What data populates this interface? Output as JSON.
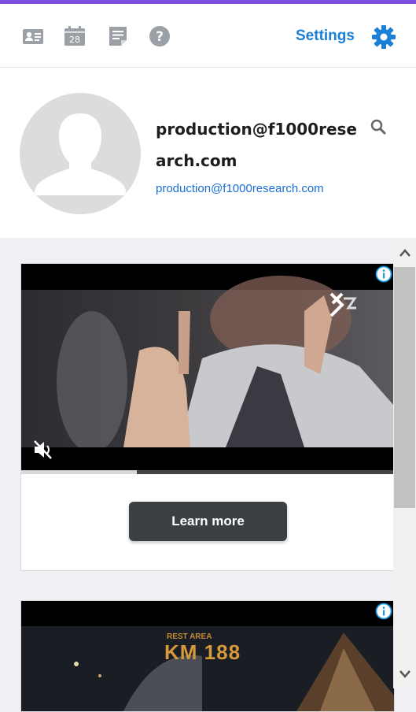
{
  "toolbar": {
    "icons": [
      "contact-card-icon",
      "calendar-icon",
      "notes-icon",
      "help-icon"
    ],
    "calendar_day": "28",
    "settings_label": "Settings",
    "accent_color": "#1a7fd6",
    "top_stripe_color": "#7b4fe0"
  },
  "profile": {
    "username": "production@f1000research.com",
    "email": "production@f1000research.com",
    "avatar_icon": "person-silhouette-icon"
  },
  "ads": [
    {
      "video_progress": 0.31,
      "muted": true,
      "cta_label": "Learn more",
      "info_icon": "info-icon"
    },
    {
      "overlay_small": "REST AREA",
      "overlay_text": "KM 188",
      "info_icon": "info-icon"
    }
  ],
  "scrollbar": {
    "up_icon": "chevron-up-icon",
    "down_icon": "chevron-down-icon"
  }
}
